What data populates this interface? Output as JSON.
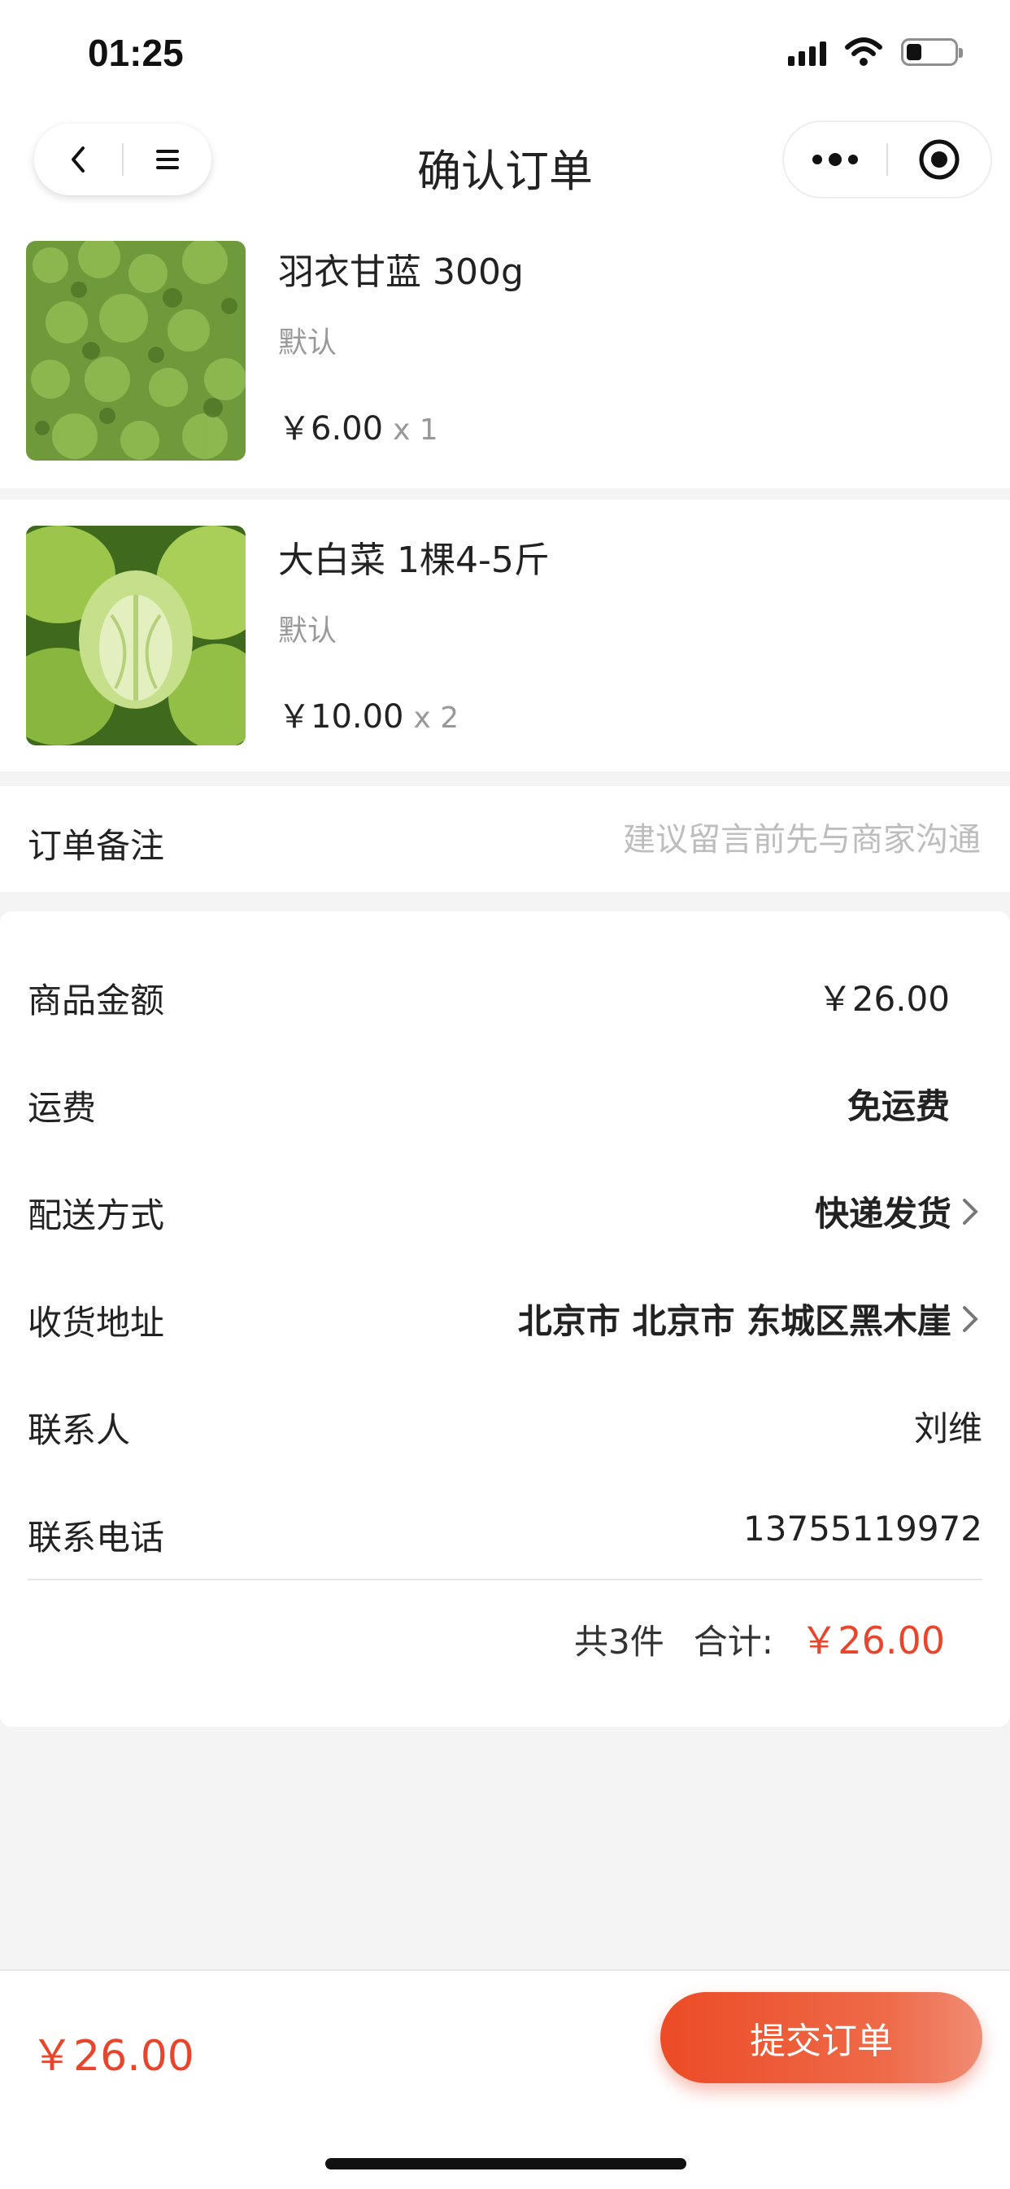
{
  "status_bar": {
    "time": "01:25",
    "icons": [
      "signal-icon",
      "wifi-icon",
      "battery-icon"
    ]
  },
  "nav": {
    "title": "确认订单",
    "left_icons": [
      "back-icon",
      "home-menu-icon"
    ],
    "right_icons": [
      "more-icon",
      "close-target-icon"
    ]
  },
  "products": [
    {
      "name": "羽衣甘蓝 300g",
      "spec": "默认",
      "price": "￥6.00",
      "qty": "x 1",
      "image": "kale-photo"
    },
    {
      "name": "大白菜 1棵4-5斤",
      "spec": "默认",
      "price": "￥10.00",
      "qty": "x 2",
      "image": "napa-cabbage-photo"
    }
  ],
  "remark": {
    "label": "订单备注",
    "placeholder": "建议留言前先与商家沟通",
    "value": ""
  },
  "summary": {
    "goods_amount_label": "商品金额",
    "goods_amount_value": "￥26.00",
    "shipping_label": "运费",
    "shipping_value": "免运费",
    "delivery_label": "配送方式",
    "delivery_value": "快递发货",
    "address_label": "收货地址",
    "address_value": "北京市 北京市 东城区黑木崖",
    "contact_label": "联系人",
    "contact_value": "刘维",
    "phone_label": "联系电话",
    "phone_value": "13755119972",
    "count_text": "共3件",
    "total_label": "合计:",
    "total_value": "￥26.00"
  },
  "bottom_bar": {
    "price": "￥26.00",
    "submit_label": "提交订单"
  },
  "colors": {
    "accent": "#e8462c",
    "page_bg": "#f4f4f4",
    "text": "#222222",
    "muted": "#999999"
  }
}
